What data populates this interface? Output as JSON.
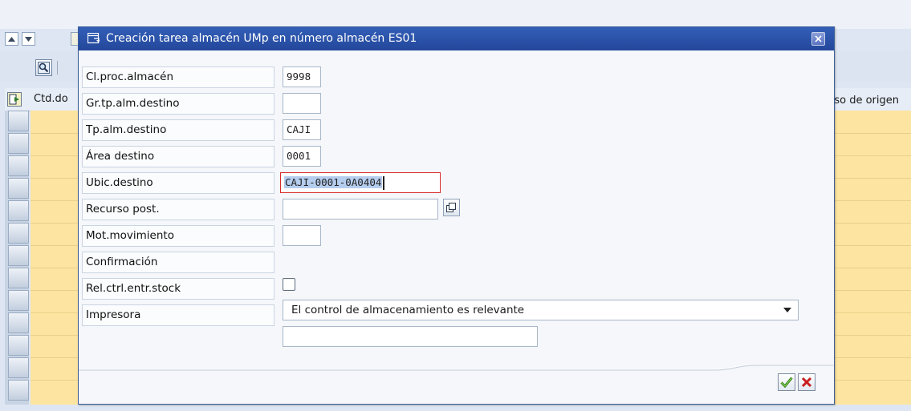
{
  "colors": {
    "titlebar": "#2a51a8",
    "grid_yellow": "#fde4a0",
    "focus_border": "#d72c2c",
    "selection": "#b5cdee"
  },
  "background": {
    "nav_icons": [
      "arrow-up-icon",
      "arrow-down-icon"
    ],
    "find_icon": "find-icon",
    "grid": {
      "header_left": "Ctd.do",
      "header_right": "rso de origen"
    }
  },
  "dialog": {
    "title": "Creación tarea almacén UMp en número almacén ES01",
    "title_icon": "dialog-window-icon",
    "close_icon": "close-icon",
    "fields": {
      "cl_proc": {
        "label": "Cl.proc.almacén",
        "value": "9998"
      },
      "gr_tp_alm": {
        "label": "Gr.tp.alm.destino",
        "value": ""
      },
      "tp_alm": {
        "label": "Tp.alm.destino",
        "value": "CAJI"
      },
      "area": {
        "label": "Área destino",
        "value": "0001"
      },
      "ubic": {
        "label": "Ubic.destino",
        "value": "CAJI-0001-0A0404"
      },
      "recurso": {
        "label": "Recurso post.",
        "value": ""
      },
      "mot": {
        "label": "Mot.movimiento",
        "value": ""
      },
      "confirmacion": {
        "label": "Confirmación",
        "checked": false
      },
      "rel_ctrl": {
        "label": "Rel.ctrl.entr.stock",
        "value": "El control de almacenamiento es relevante"
      },
      "impresora": {
        "label": "Impresora",
        "value": ""
      }
    },
    "buttons": {
      "ok_icon": "checkmark-icon",
      "cancel_icon": "cancel-x-icon",
      "possible_entries_icon": "possible-entries-icon"
    }
  }
}
